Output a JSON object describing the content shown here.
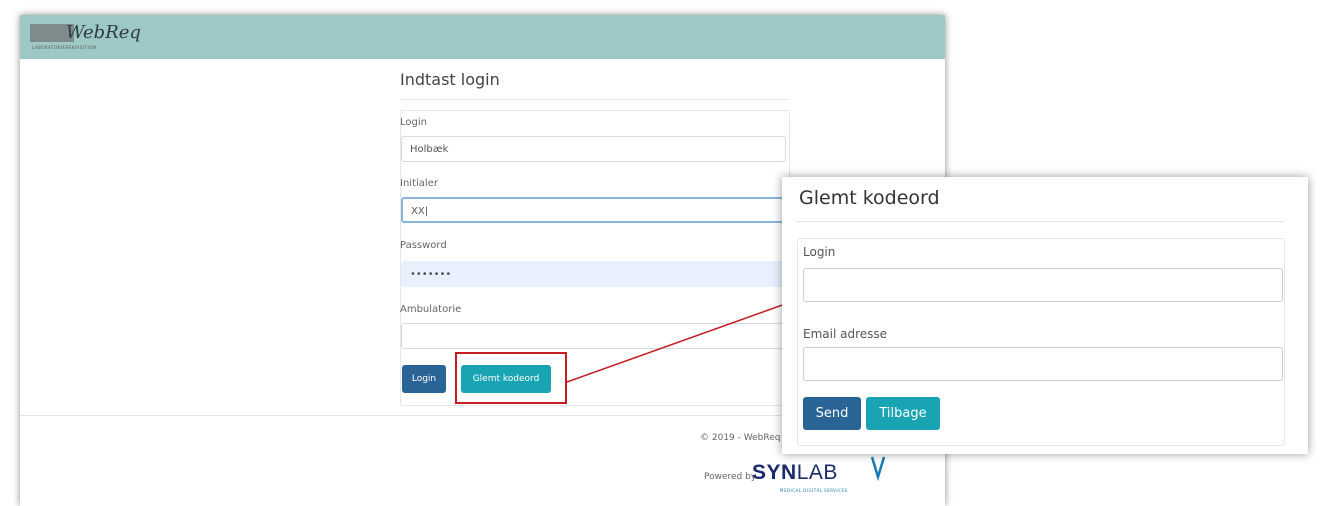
{
  "logo": {
    "text": "WebReq",
    "subtext": "LABORATORIEREKVISITION"
  },
  "login_form": {
    "title": "Indtast login",
    "login_label": "Login",
    "login_value": "Holbæk",
    "initialer_label": "Initialer",
    "initialer_value": "XX|",
    "password_label": "Password",
    "password_value": "•••••••",
    "ambulatorie_label": "Ambulatorie",
    "ambulatorie_value": "",
    "login_button": "Login",
    "glemt_button": "Glemt kodeord"
  },
  "footer": {
    "copyright": "© 2019 - WebReq",
    "powered_by": "Powered by",
    "brand_a": "SYN",
    "brand_b": "LAB",
    "brand_sub": "MEDICAL DIGITAL SERVICES"
  },
  "popup": {
    "title": "Glemt kodeord",
    "login_label": "Login",
    "email_label": "Email adresse",
    "send_button": "Send",
    "tilbage_button": "Tilbage"
  },
  "colors": {
    "header": "#9ec8c6",
    "primary": "#2a6496",
    "accent": "#18a4b2",
    "annotation_red": "#c41e24",
    "brand": "#1a2a6c"
  }
}
